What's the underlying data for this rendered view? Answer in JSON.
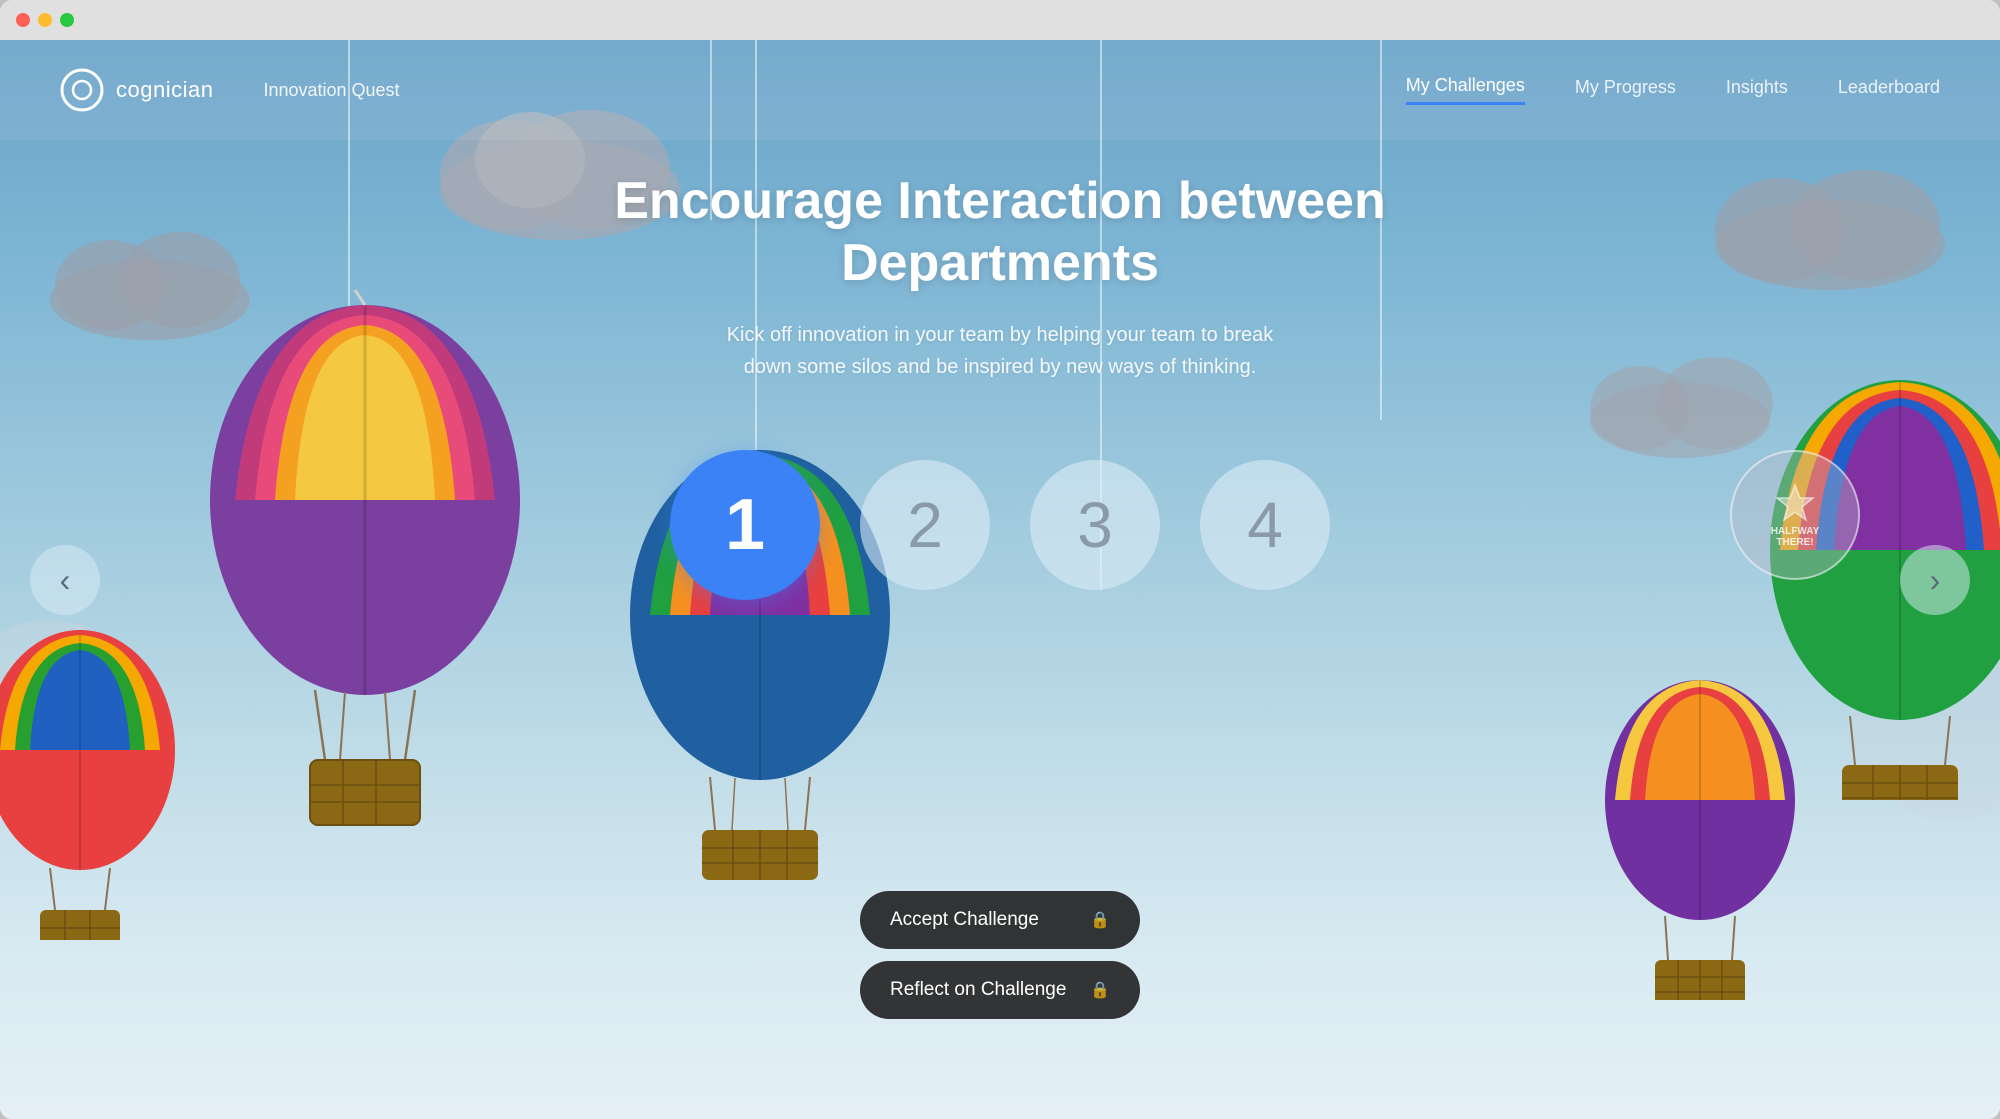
{
  "window": {
    "title": "Cognician - Innovation Quest"
  },
  "navbar": {
    "logo_text": "cognician",
    "app_title": "Innovation Quest",
    "links": [
      {
        "id": "my-challenges",
        "label": "My Challenges",
        "active": true
      },
      {
        "id": "my-progress",
        "label": "My Progress",
        "active": false
      },
      {
        "id": "insights",
        "label": "Insights",
        "active": false
      },
      {
        "id": "leaderboard",
        "label": "Leaderboard",
        "active": false
      }
    ]
  },
  "hero": {
    "title": "Encourage Interaction between Departments",
    "subtitle": "Kick off innovation in your team by helping your team to break\ndown some silos and be inspired by new ways of thinking."
  },
  "steps": [
    {
      "number": "1",
      "active": true
    },
    {
      "number": "2",
      "active": false
    },
    {
      "number": "3",
      "active": false
    },
    {
      "number": "4",
      "active": false
    }
  ],
  "actions": [
    {
      "id": "accept-challenge",
      "label": "Accept Challenge",
      "locked": true
    },
    {
      "id": "reflect-challenge",
      "label": "Reflect on Challenge",
      "locked": true
    }
  ],
  "nav_arrows": {
    "left": "‹",
    "right": "›"
  },
  "halfway_badge": {
    "line1": "HALFWAY",
    "line2": "THERE!"
  }
}
